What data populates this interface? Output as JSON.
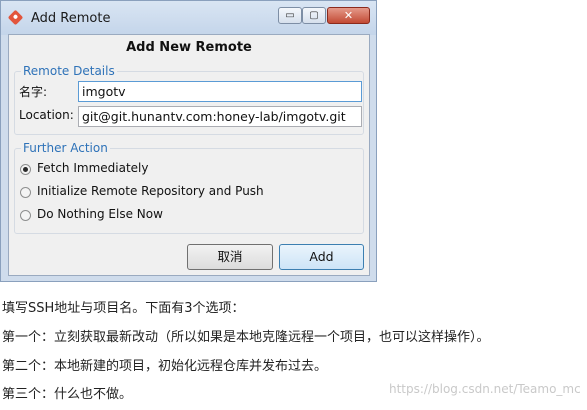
{
  "window": {
    "title": "Add Remote",
    "min_glyph": "▭",
    "max_glyph": "▢",
    "close_glyph": "✕"
  },
  "dialog": {
    "heading": "Add New Remote",
    "remote_details": {
      "group_title": "Remote Details",
      "name_label": "名字:",
      "name_value": "imgotv",
      "location_label": "Location:",
      "location_value": "git@git.hunantv.com:honey-lab/imgotv.git"
    },
    "further_action": {
      "group_title": "Further Action",
      "options": [
        {
          "label": "Fetch Immediately",
          "selected": true
        },
        {
          "label": "Initialize Remote Repository and Push",
          "selected": false
        },
        {
          "label": "Do Nothing Else Now",
          "selected": false
        }
      ]
    },
    "buttons": {
      "cancel": "取消",
      "add": "Add"
    }
  },
  "article": {
    "lines": [
      "填写SSH地址与项目名。下面有3个选项：",
      "第一个：立刻获取最新改动（所以如果是本地克隆远程一个项目，也可以这样操作）。",
      "第二个：本地新建的项目，初始化远程仓库并发布过去。",
      "第三个：什么也不做。"
    ],
    "watermark": "https://blog.csdn.net/Teamo_mc"
  }
}
